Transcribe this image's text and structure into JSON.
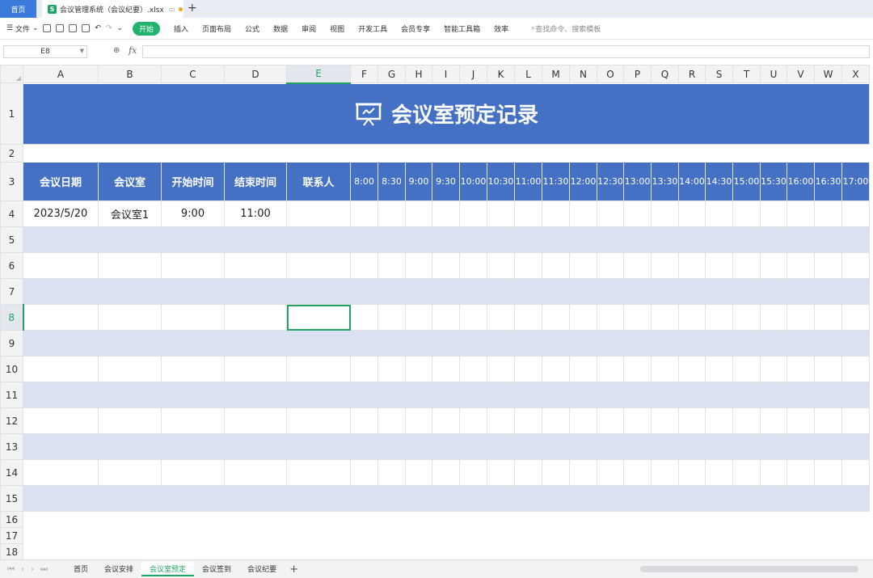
{
  "tabs": {
    "home": "首页",
    "file": "会议管理系统（会议纪要）.xlsx"
  },
  "toolbar": {
    "file_menu": "文件",
    "start_tab": "开始",
    "menus": [
      "插入",
      "页面布局",
      "公式",
      "数据",
      "审阅",
      "视图",
      "开发工具",
      "会员专享",
      "智能工具箱",
      "效率"
    ],
    "search_placeholder": "查找命令、搜索模板"
  },
  "formula_bar": {
    "name_box": "E8",
    "fx_label": "fx",
    "content": ""
  },
  "columns": [
    "A",
    "B",
    "C",
    "D",
    "E",
    "F",
    "G",
    "H",
    "I",
    "J",
    "K",
    "L",
    "M",
    "N",
    "O",
    "P",
    "Q",
    "R",
    "S",
    "T",
    "U",
    "V",
    "W",
    "X"
  ],
  "rows": [
    "1",
    "2",
    "3",
    "4",
    "5",
    "6",
    "7",
    "8",
    "9",
    "10",
    "11",
    "12",
    "13",
    "14",
    "15",
    "16",
    "17",
    "18"
  ],
  "sheet": {
    "title": "会议室预定记录",
    "headers": [
      "会议日期",
      "会议室",
      "开始时间",
      "结束时间",
      "联系人"
    ],
    "times": [
      "8:00",
      "8:30",
      "9:00",
      "9:30",
      "10:00",
      "10:30",
      "11:00",
      "11:30",
      "12:00",
      "12:30",
      "13:00",
      "13:30",
      "14:00",
      "14:30",
      "15:00",
      "15:30",
      "16:00",
      "16:30",
      "17:00"
    ],
    "records": [
      {
        "date": "2023/5/20",
        "room": "会议室1",
        "start": "9:00",
        "end": "11:00",
        "contact": ""
      }
    ],
    "selected_cell": "E8"
  },
  "sheet_tabs": [
    "首页",
    "会议安排",
    "会议室预定",
    "会议签到",
    "会议纪要"
  ],
  "active_sheet": "会议室预定",
  "colors": {
    "header_blue": "#4471c4",
    "band_blue": "#d9e1f2",
    "accent_green": "#21a366"
  }
}
